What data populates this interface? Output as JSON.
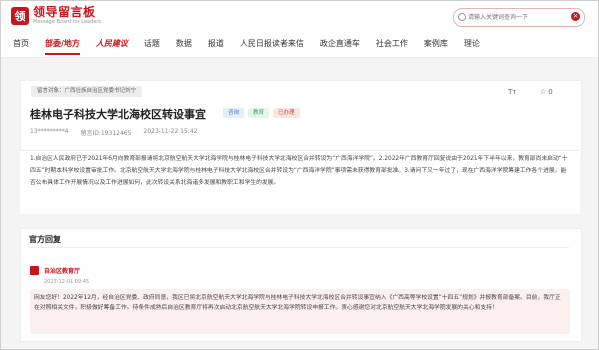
{
  "header": {
    "logo_mark": "领",
    "logo_title": "领导留言板",
    "logo_subtitle": "Message Board for Leaders",
    "search_placeholder": "请输入关键词查询一下",
    "search_clear": "×"
  },
  "nav": {
    "items": [
      {
        "label": "首页"
      },
      {
        "label": "部委/地方"
      },
      {
        "label": "人民建议"
      },
      {
        "label": "话题"
      },
      {
        "label": "数据"
      },
      {
        "label": "报道"
      },
      {
        "label": "人民日报读者来信"
      },
      {
        "label": "政企直通车"
      },
      {
        "label": "社会工作"
      },
      {
        "label": "案例库"
      },
      {
        "label": "理论"
      }
    ]
  },
  "message": {
    "object_tag": "留言对象：广西壮族自治区党委书记刘宁",
    "font_icon": "Tт",
    "like_count": "0",
    "title": "桂林电子科技大学北海校区转设事宜",
    "tags": [
      "咨询",
      "教育",
      "已办理"
    ],
    "user": "13*********4",
    "message_id": "留言ID:19312465",
    "time": "2023-11-22 15:42",
    "content": "1.自治区人民政府已于2021年6月向教育部报请将北京航空航天大学北海学院与桂林电子科技大学北海校区合并转设为“广西海洋学院”。2.2022年广西教育厅回复说由于2021年下半年以来，教育部尚未启动“十四五”时期本科学校设置审批工作。北京航空航天大学北海学院与桂林电子科技大学北海校区合并转设为“广西海洋学院”事项需未获得教育部批准。3.请问下又一年过了，现在广西海洋学院筹建工作各个进展，能否公布具体工作开展情况以及工作进展如何，此次转设关系北海诸多发展和教职工和学生的发展。"
  },
  "reply": {
    "section_title": "官方回复",
    "org": "自治区教育厅",
    "date": "2023-12-01 09:45",
    "content": "网友您好！2022年12月，经自治区党委、政府同意，我区已将北京航空航天大学北海学院与桂林电子科技大学北海校区合并转设事宜纳入《广西高等学校设置“十四五”规划》并报教育部备案。目前，我厅正在对照相关文件，积极做好筹备工作。待条件成熟后自治区教育厅将再次启动北京航空航天大学北海学院转设申报工作。衷心感谢您对北京航空航天大学北海学院发展的关心和支持！"
  },
  "colors": {
    "brand_red": "#c8161d"
  }
}
